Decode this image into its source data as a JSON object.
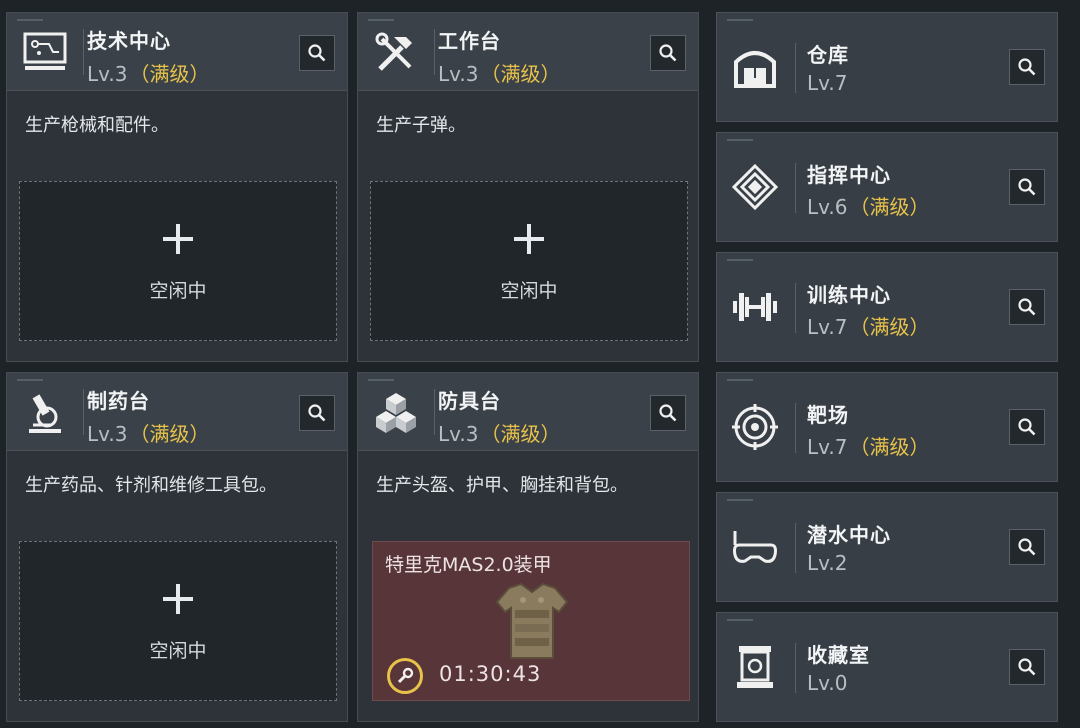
{
  "facilities": {
    "tech_center": {
      "title": "技术中心",
      "level": "Lv.3",
      "max": "（满级）",
      "desc": "生产枪械和配件。",
      "slot": "空闲中",
      "icon": "monitor-icon"
    },
    "workbench": {
      "title": "工作台",
      "level": "Lv.3",
      "max": "（满级）",
      "desc": "生产子弹。",
      "slot": "空闲中",
      "icon": "tools-icon"
    },
    "pharmacy": {
      "title": "制药台",
      "level": "Lv.3",
      "max": "（满级）",
      "desc": "生产药品、针剂和维修工具包。",
      "slot": "空闲中",
      "icon": "microscope-icon"
    },
    "armory": {
      "title": "防具台",
      "level": "Lv.3",
      "max": "（满级）",
      "desc": "生产头盔、护甲、胸挂和背包。",
      "icon": "blocks-icon",
      "production": {
        "item": "特里克MAS2.0装甲",
        "timer": "01:30:43"
      }
    }
  },
  "sidebar": [
    {
      "title": "仓库",
      "level": "Lv.7",
      "max": "",
      "icon": "warehouse-icon"
    },
    {
      "title": "指挥中心",
      "level": "Lv.6",
      "max": "（满级）",
      "icon": "chip-icon"
    },
    {
      "title": "训练中心",
      "level": "Lv.7",
      "max": "（满级）",
      "icon": "dumbbell-icon"
    },
    {
      "title": "靶场",
      "level": "Lv.7",
      "max": "（满级）",
      "icon": "target-icon"
    },
    {
      "title": "潜水中心",
      "level": "Lv.2",
      "max": "",
      "icon": "diving-mask-icon"
    },
    {
      "title": "收藏室",
      "level": "Lv.0",
      "max": "",
      "icon": "display-case-icon"
    }
  ],
  "colors": {
    "accent_gold": "#e8c24a",
    "busy_bg": "#573539",
    "card_bg": "#2d3339"
  }
}
